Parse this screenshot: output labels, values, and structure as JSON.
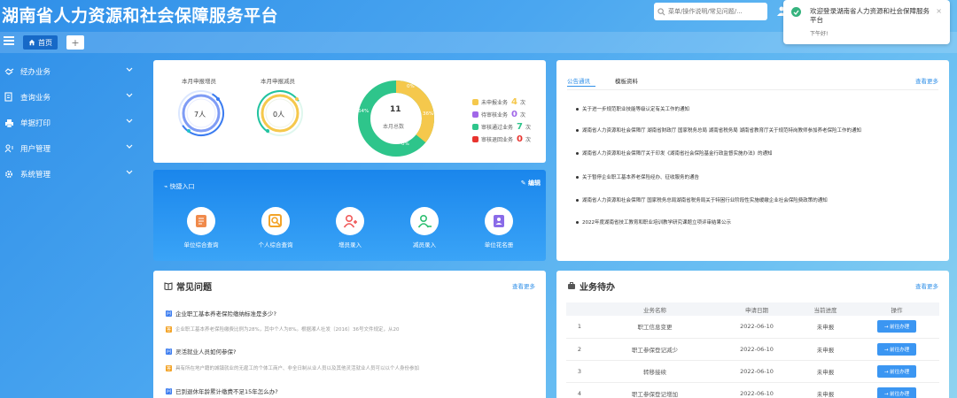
{
  "header": {
    "title": "湖南省人力资源和社会保障服务平台",
    "search_placeholder": "菜单/操作说明/常见问题/..."
  },
  "tabs": {
    "home": "首页",
    "add": "+"
  },
  "sidebar": {
    "items": [
      {
        "label": "经办业务",
        "icon": "handshake-icon"
      },
      {
        "label": "查询业务",
        "icon": "document-icon"
      },
      {
        "label": "单据打印",
        "icon": "printer-icon"
      },
      {
        "label": "用户管理",
        "icon": "user-manage-icon"
      },
      {
        "label": "系统管理",
        "icon": "gear-icon"
      }
    ]
  },
  "stats": {
    "add_label": "本月申报增员",
    "add_value": "7人",
    "reduce_label": "本月申报减员",
    "reduce_value": "0人",
    "total_value": "11",
    "total_label": "本月总数",
    "pct_top": "0%",
    "pct_left": "64%",
    "pct_right": "36%",
    "pct_bottom": "0%",
    "legend": [
      {
        "label": "未申报业务",
        "value": "4",
        "unit": "次",
        "color": "#f5c84c"
      },
      {
        "label": "待审核业务",
        "value": "0",
        "unit": "次",
        "color": "#a167e8"
      },
      {
        "label": "审核通过业务",
        "value": "7",
        "unit": "次",
        "color": "#2ec58b"
      },
      {
        "label": "审核退回业务",
        "value": "0",
        "unit": "次",
        "color": "#e8342f"
      }
    ]
  },
  "quick": {
    "title": "快捷入口",
    "edit": "编辑",
    "items": [
      {
        "label": "单位综合查询",
        "color": "#f08a4b"
      },
      {
        "label": "个人综合查询",
        "color": "#f3a327"
      },
      {
        "label": "增员录入",
        "color": "#f05a5a"
      },
      {
        "label": "减员录入",
        "color": "#2fbf71"
      },
      {
        "label": "单位花名册",
        "color": "#8a6be8"
      }
    ]
  },
  "notice": {
    "tab_active": "公告通讯",
    "tab_other": "模板资料",
    "more": "查看更多",
    "items": [
      "关于进一步规范职业技能等级认定有关工作的通知",
      "湖南省人力资源和社会保障厅 湖南省财政厅 国家税务总局 湖南省税务局 湖南省教育厅关于规范特岗教师参加养老保险工作的通知",
      "湖南省人力资源和社会保障厅关于印发《湖南省社会保险基金行政监督实施办法》的通知",
      "关于暂停企业职工基本养老保险经办、征收服务的通告",
      "湖南省人力资源和社会保障厅 国家税务总局湖南省税务局关于特困行业阶段性实施缓缴企业社会保险费政策的通知",
      "2022年度湖南省技工教育和职业培训教学研究课题立项评审结果公示"
    ]
  },
  "faq": {
    "title": "常见问题",
    "more": "查看更多",
    "items": [
      {
        "q": "企业职工基本养老保险缴纳标准是多少?",
        "a": "企业职工基本养老保险缴费比例为28%，其中个人为8%。根据湘人社发〔2016〕36号文件规定，从20"
      },
      {
        "q": "灵活就业人员如何参保?",
        "a": "具有所在地户籍的城镇就业的无雇工的个体工商户、非全日制从业人员以及其他灵活就业人员可以以个人身份参加"
      },
      {
        "q": "已到退休年龄累计缴费不足15年怎么办?",
        "a": ""
      }
    ]
  },
  "todo": {
    "title": "业务待办",
    "more": "查看更多",
    "columns": [
      "",
      "业务名称",
      "申请日期",
      "当前进度",
      "操作"
    ],
    "rows": [
      {
        "no": "1",
        "name": "职工信息变更",
        "date": "2022-06-10",
        "status": "未申报",
        "action": "前往办理"
      },
      {
        "no": "2",
        "name": "职工参保登记减少",
        "date": "2022-06-10",
        "status": "未申报",
        "action": "前往办理"
      },
      {
        "no": "3",
        "name": "转移接续",
        "date": "2022-06-10",
        "status": "未申报",
        "action": "前往办理"
      },
      {
        "no": "4",
        "name": "职工参保登记增加",
        "date": "2022-06-10",
        "status": "未申报",
        "action": "前往办理"
      }
    ]
  },
  "toast": {
    "message": "欢迎登录湖南省人力资源和社会保障服务平台",
    "sub": "下午好!",
    "close": "×"
  }
}
